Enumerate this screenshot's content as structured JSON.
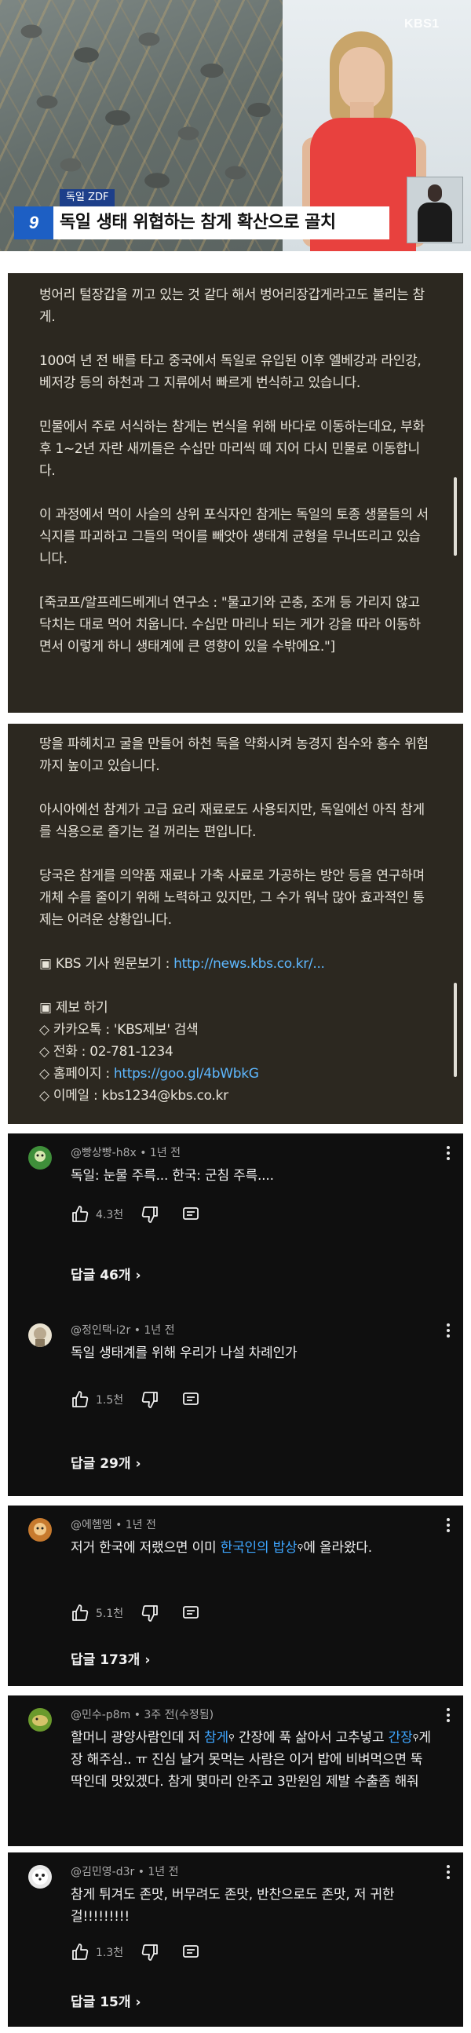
{
  "video": {
    "channel_logo": "KBS1",
    "source_chip": "독일 ZDF",
    "badge": "9",
    "headline": "독일 생태 위협하는 참게 확산으로 골치"
  },
  "description": {
    "paragraphs_1": [
      "벙어리 털장갑을 끼고 있는 것 같다 해서 벙어리장갑게라고도 불리는 참게.",
      "100여 년 전 배를 타고 중국에서 독일로 유입된 이후  엘베강과 라인강, 베저강 등의 하천과 그 지류에서 빠르게 번식하고 있습니다.",
      "민물에서 주로 서식하는 참게는 번식을 위해 바다로 이동하는데요, 부화 후 1~2년 자란 새끼들은  수십만 마리씩 떼 지어 다시 민물로 이동합니다.",
      "이 과정에서 먹이 사슬의 상위 포식자인 참게는 독일의 토종 생물들의 서식지를 파괴하고 그들의 먹이를 빼앗아 생태계 균형을 무너뜨리고 있습니다.",
      "[죽코프/알프레드베게너 연구소  : \"물고기와 곤충, 조개 등 가리지 않고 닥치는 대로 먹어 치웁니다. 수십만 마리나 되는 게가 강을 따라 이동하면서 이렇게 하니 생태계에 큰 영향이 있을 수밖에요.\"]"
    ],
    "paragraphs_2": [
      "땅을 파헤치고 굴을 만들어 하천 둑을 약화시켜  농경지 침수와 홍수 위험까지 높이고 있습니다.",
      "아시아에선 참게가 고급 요리 재료로도 사용되지만, 독일에선 아직 참게를 식용으로 즐기는 걸 꺼리는 편입니다.",
      "당국은  참게를 의약품 재료나 가축 사료로 가공하는 방안 등을 연구하며 개체 수를 줄이기 위해 노력하고 있지만, 그 수가 워낙 많아 효과적인 통제는 어려운 상황입니다."
    ],
    "original_label": "▣ KBS 기사 원문보기 : ",
    "original_link": "http://news.kbs.co.kr/...",
    "tip_title": "▣ 제보 하기",
    "tip_kakao": "◇ 카카오톡 : 'KBS제보' 검색",
    "tip_phone": "◇ 전화 : 02-781-1234",
    "tip_home_label": "◇ 홈페이지 : ",
    "tip_home_link": "https://goo.gl/4bWbkG",
    "tip_email": "◇ 이메일 : kbs1234@kbs.co.kr"
  },
  "comments": [
    {
      "meta": "@빵상빵-h8x • 1년 전",
      "text": "독일: 눈물 주륵... 한국: 군침 주륵....",
      "likes": "4.3천",
      "replies": "답글 46개",
      "avatar_color": "#3f8f3a"
    },
    {
      "meta": "@정인택-i2r • 1년 전",
      "text": "독일 생태계를 위해 우리가 나설 차례인가",
      "likes": "1.5천",
      "replies": "답글 29개",
      "avatar_color": "#b9a98f"
    },
    {
      "meta": "@에헴엠 • 1년 전",
      "text_pre": "저거 한국에 저랬으면 이미 ",
      "text_link": "한국인의 밥상",
      "text_post": "에 올라왔다.",
      "likes": "5.1천",
      "replies": "답글 173개",
      "avatar_color": "#c77a2e"
    },
    {
      "meta": "@민수-p8m • 3주 전(수정됨)",
      "text_a": "할머니 광양사람인데 저 ",
      "text_link1": "참게",
      "text_b": " 간장에 푹 삶아서 고추넣고 ",
      "text_link2": "간장",
      "text_c": "게장 해주심.. ㅠ 진심 날거 못먹는 사람은 이거 밥에 비벼먹으면 뚝딱인데 맛있겠다. 참게 몇마리 안주고 3만원임 제발 수출좀 해줘",
      "avatar_color": "#6a9a2c"
    },
    {
      "meta": "@김민영-d3r • 1년 전",
      "text": "참게 튀겨도 존맛, 버무려도 존맛, 반찬으로도 존맛, 저 귀한걸!!!!!!!!!",
      "likes": "1.3천",
      "replies": "답글 15개",
      "avatar_color": "#e8e8e8"
    }
  ],
  "colors": {
    "panel_bg": "#2c2820",
    "card_bg": "#0f0f0f",
    "link": "#3ea6ff",
    "news_badge": "#1d5fc4"
  },
  "icons": [
    "like-icon",
    "dislike-icon",
    "reply-icon",
    "more-vert-icon",
    "chevron-right-icon"
  ]
}
